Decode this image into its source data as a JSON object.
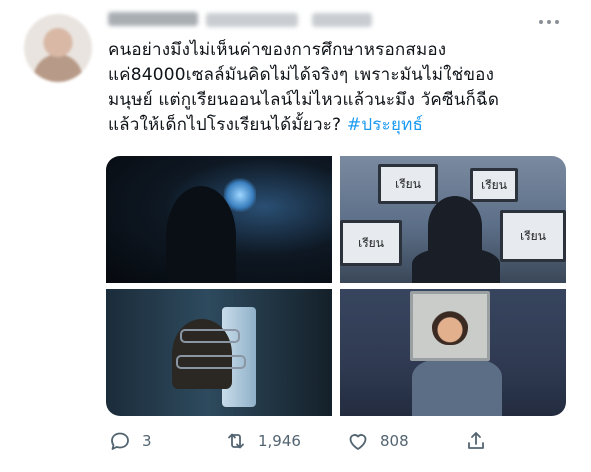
{
  "tweet": {
    "lines": [
      "คนอย่างมึงไม่เห็นค่าของการศึกษาหรอกสมอง",
      "แค่84000เซลล์มันคิดไม่ได้จริงๆ เพราะมันไม่ใช่ของ",
      "มนุษย์ แต่กูเรียนออนไลน์ไม่ไหวแล้วนะมึง วัคซีนก็ฉีด",
      "แล้วให้เด็กไปโรงเรียนได้มั้ยวะ?"
    ],
    "hashtag": "#ประยุทธ์"
  },
  "media": {
    "monitor_label": "เรียน"
  },
  "actions": {
    "reply_count": "3",
    "retweet_count": "1,946",
    "like_count": "808"
  },
  "icons": [
    "more-icon",
    "reply-icon",
    "retweet-icon",
    "like-icon",
    "share-icon"
  ],
  "colors": {
    "hashtag": "#1d9bf0",
    "action_gray": "#536471",
    "text": "#0f1419"
  }
}
